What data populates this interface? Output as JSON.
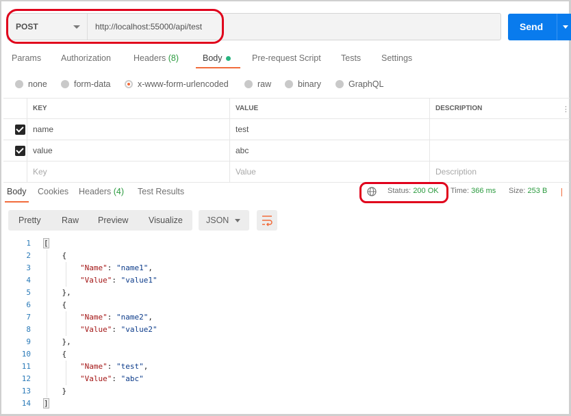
{
  "request": {
    "method": "POST",
    "url": "http://localhost:55000/api/test",
    "send_label": "Send"
  },
  "tabs": [
    {
      "label": "Params"
    },
    {
      "label": "Authorization"
    },
    {
      "label": "Headers",
      "count": "(8)"
    },
    {
      "label": "Body"
    },
    {
      "label": "Pre-request Script"
    },
    {
      "label": "Tests"
    },
    {
      "label": "Settings"
    }
  ],
  "body_types": [
    {
      "label": "none"
    },
    {
      "label": "form-data"
    },
    {
      "label": "x-www-form-urlencoded",
      "selected": true
    },
    {
      "label": "raw"
    },
    {
      "label": "binary"
    },
    {
      "label": "GraphQL"
    }
  ],
  "params_table": {
    "headers": [
      "KEY",
      "VALUE",
      "DESCRIPTION"
    ],
    "rows": [
      {
        "key": "name",
        "value": "test",
        "description": "",
        "checked": true
      },
      {
        "key": "value",
        "value": "abc",
        "description": "",
        "checked": true
      }
    ],
    "placeholders": {
      "key": "Key",
      "value": "Value",
      "description": "Description"
    }
  },
  "response": {
    "tabs": [
      {
        "label": "Body"
      },
      {
        "label": "Cookies"
      },
      {
        "label": "Headers",
        "count": "(4)"
      },
      {
        "label": "Test Results"
      }
    ],
    "status_label": "Status:",
    "status_value": "200 OK",
    "time_label": "Time:",
    "time_value": "366 ms",
    "size_label": "Size:",
    "size_value": "253 B",
    "format_buttons": [
      "Pretty",
      "Raw",
      "Preview",
      "Visualize"
    ],
    "language": "JSON",
    "code_lines": [
      {
        "n": "1",
        "t": "["
      },
      {
        "n": "2",
        "t": "    {"
      },
      {
        "n": "3",
        "k": "\"Name\"",
        "v": "\"name1\"",
        "end": ","
      },
      {
        "n": "4",
        "k": "\"Value\"",
        "v": "\"value1\"",
        "end": ""
      },
      {
        "n": "5",
        "t": "    },"
      },
      {
        "n": "6",
        "t": "    {"
      },
      {
        "n": "7",
        "k": "\"Name\"",
        "v": "\"name2\"",
        "end": ","
      },
      {
        "n": "8",
        "k": "\"Value\"",
        "v": "\"value2\"",
        "end": ""
      },
      {
        "n": "9",
        "t": "    },"
      },
      {
        "n": "10",
        "t": "    {"
      },
      {
        "n": "11",
        "k": "\"Name\"",
        "v": "\"test\"",
        "end": ","
      },
      {
        "n": "12",
        "k": "\"Value\"",
        "v": "\"abc\"",
        "end": ""
      },
      {
        "n": "13",
        "t": "    }"
      },
      {
        "n": "14",
        "t": "]"
      }
    ]
  },
  "colors": {
    "accent": "#f26b3a",
    "send_blue": "#097bed",
    "success_green": "#2a9a3e",
    "annotation_red": "#e0001b"
  }
}
